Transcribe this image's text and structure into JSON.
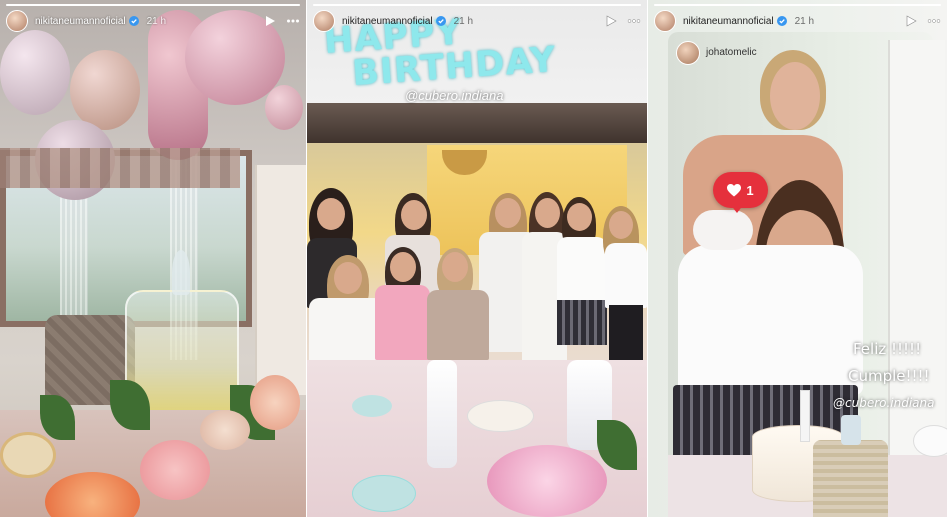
{
  "stories": [
    {
      "username": "nikitaneumannoficial",
      "time": "21 h",
      "progress_fraction": 1.0
    },
    {
      "username": "nikitaneumannoficial",
      "time": "21 h",
      "progress_fraction": 1.0,
      "sticker_text": "HAPPY BIRTHDAY",
      "mention": "@cubero.indiana"
    },
    {
      "username": "nikitaneumannoficial",
      "time": "21 h",
      "progress_fraction": 1.0,
      "reshared_from": "johatomelic",
      "like_count": "1",
      "caption_line1": "Feliz !!!!!",
      "caption_line2": "Cumple!!!!",
      "mention": "@cubero.indiana"
    }
  ],
  "icons": {
    "verified": "verified-badge-icon",
    "play": "play-icon",
    "more": "more-options-icon",
    "heart": "heart-icon"
  },
  "colors": {
    "like_bubble": "#e5303c",
    "verified": "#3897f0",
    "birthday_sticker": "#8ee8ec"
  }
}
